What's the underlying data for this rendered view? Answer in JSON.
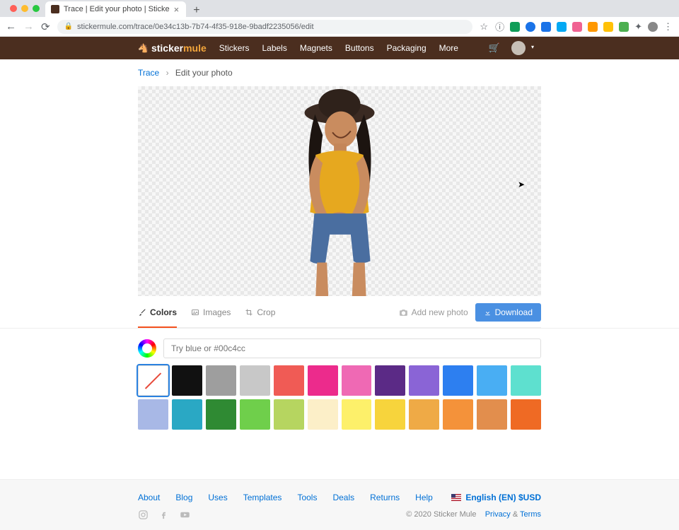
{
  "browser": {
    "tab_title": "Trace | Edit your photo | Sticke",
    "url": "stickermule.com/trace/0e34c13b-7b74-4f35-918e-9badf2235056/edit"
  },
  "header": {
    "brand_prefix": "sticker",
    "brand_suffix": "mule",
    "nav": [
      "Stickers",
      "Labels",
      "Magnets",
      "Buttons",
      "Packaging",
      "More"
    ]
  },
  "breadcrumb": {
    "root": "Trace",
    "current": "Edit your photo"
  },
  "tools": {
    "colors": "Colors",
    "images": "Images",
    "crop": "Crop",
    "add_new_photo": "Add new photo",
    "download": "Download"
  },
  "color_editor": {
    "placeholder": "Try blue or #00c4cc",
    "swatches": [
      {
        "name": "transparent",
        "color": "#ffffff",
        "selected": true,
        "transparent": true
      },
      {
        "name": "black",
        "color": "#111111"
      },
      {
        "name": "dark-gray",
        "color": "#9e9e9e"
      },
      {
        "name": "gray",
        "color": "#c8c8c8"
      },
      {
        "name": "coral",
        "color": "#f05b55"
      },
      {
        "name": "magenta",
        "color": "#ec2b8c"
      },
      {
        "name": "pink",
        "color": "#ef69b4"
      },
      {
        "name": "dark-purple",
        "color": "#5b2a86"
      },
      {
        "name": "purple",
        "color": "#8a64d6"
      },
      {
        "name": "blue",
        "color": "#2d7ff0"
      },
      {
        "name": "sky",
        "color": "#49aef3"
      },
      {
        "name": "teal",
        "color": "#5ee0cf"
      },
      {
        "name": "periwinkle",
        "color": "#a8b8e6"
      },
      {
        "name": "cyan",
        "color": "#2aa8c4"
      },
      {
        "name": "dark-green",
        "color": "#2f8a33"
      },
      {
        "name": "green",
        "color": "#6fcf4b"
      },
      {
        "name": "olive",
        "color": "#b6d560"
      },
      {
        "name": "cream",
        "color": "#fcefc8"
      },
      {
        "name": "lemon",
        "color": "#fdf06a"
      },
      {
        "name": "yellow",
        "color": "#f7d43c"
      },
      {
        "name": "light-orange",
        "color": "#efaa46"
      },
      {
        "name": "orange",
        "color": "#f4923a"
      },
      {
        "name": "tan-orange",
        "color": "#e28e4d"
      },
      {
        "name": "dark-orange",
        "color": "#ef6a24"
      }
    ]
  },
  "footer": {
    "links": [
      "About",
      "Blog",
      "Uses",
      "Templates",
      "Tools",
      "Deals",
      "Returns",
      "Help"
    ],
    "locale": "English (EN) $USD",
    "copyright": "© 2020 Sticker Mule",
    "privacy": "Privacy",
    "and": "&",
    "terms": "Terms"
  }
}
